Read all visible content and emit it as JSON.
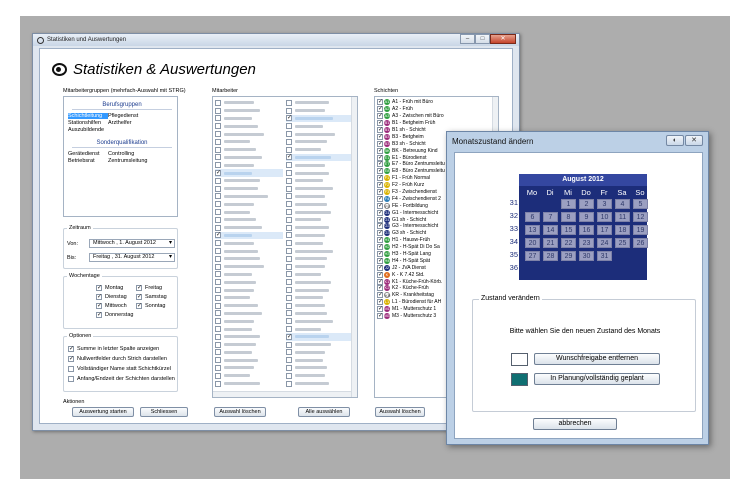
{
  "main_window": {
    "title": "Statistiken und Auswertungen",
    "heading": "Statistiken & Auswertungen",
    "mitarbeitergruppen_label": "Mitarbeitergruppen (mehrfach-Auswahl mit STRG)",
    "berufsgruppen_label": "Berufsgruppen",
    "berufsgruppen": [
      [
        "Schichtleitung",
        "Pflegedienst"
      ],
      [
        "Stationshilfen",
        "Arzthelfer"
      ],
      [
        "Auszubildende",
        ""
      ]
    ],
    "sonderqualifikation_label": "Sonderqualifikation",
    "sonderqualifikation": [
      [
        "Gerätedienst",
        "Controlling"
      ],
      [
        "Betriebsrat",
        "Zentrumsleitung"
      ]
    ],
    "zeitraum_label": "Zeitraum",
    "von_label": "Von:",
    "von_value": "Mittwoch  ,  1.   August   2012",
    "bis_label": "Bis:",
    "bis_value": "Freitag  ,  31.   August   2012",
    "wochentage_label": "Wochentage",
    "wochentage_col1": [
      "Montag",
      "Dienstag",
      "Mittwoch",
      "Donnerstag"
    ],
    "wochentage_col2": [
      "Freitag",
      "Samstag",
      "Sonntag"
    ],
    "optionen_label": "Optionen",
    "optionen": [
      {
        "label": "Summe in letzter Spalte anzeigen",
        "checked": true
      },
      {
        "label": "Nullwertfelder durch Strich darstellen",
        "checked": true
      },
      {
        "label": "Vollständiger Name statt Schichtkürzel",
        "checked": false
      },
      {
        "label": "Anfang/Endzeit der Schichten darstellen",
        "checked": false
      }
    ],
    "aktionen_label": "Aktionen",
    "auswertung_button": "Auswertung starten",
    "schliessen_button": "Schliessen",
    "mitarbeiter_label": "Mitarbeiter",
    "auswahl_loeschen_button": "Auswahl löschen",
    "alle_auswaehlen_button": "Alle auswählen",
    "schichten_label": "Schichten",
    "schichten_auswahl_loeschen_button": "Auswahl löschen",
    "schichten": [
      {
        "code": "A1",
        "label": "A1 - Früh mit Büro",
        "color": "#2f9e3f"
      },
      {
        "code": "A2",
        "label": "A2 - Früh",
        "color": "#2f9e3f"
      },
      {
        "code": "A3",
        "label": "A3 - Zwischen mit Büro",
        "color": "#2f9e3f"
      },
      {
        "code": "B1",
        "label": "B1 - Betgheim Früh",
        "color": "#9c2a7a"
      },
      {
        "code": "B1",
        "label": "B1 sh - Schicht",
        "color": "#9c2a7a"
      },
      {
        "code": "B3",
        "label": "B3 - Betgheim",
        "color": "#9c2a7a"
      },
      {
        "code": "B3",
        "label": "B3 sh - Schicht",
        "color": "#9c2a7a"
      },
      {
        "code": "BK",
        "label": "BK - Betreuung Kind",
        "color": "#2f9e3f"
      },
      {
        "code": "E1",
        "label": "E1 - Bürodienst",
        "color": "#2f9e3f"
      },
      {
        "code": "E7",
        "label": "E7 - Büro Zentrumsleitu",
        "color": "#2f9e3f"
      },
      {
        "code": "E8",
        "label": "E8 - Büro Zentrumsleitu",
        "color": "#2f9e3f"
      },
      {
        "code": "F1",
        "label": "F1 - Früh Normal",
        "color": "#d9b300"
      },
      {
        "code": "F2",
        "label": "F2 - Früh Kurz",
        "color": "#d9b300"
      },
      {
        "code": "F3",
        "label": "F3 - Zwischendienst",
        "color": "#d9b300"
      },
      {
        "code": "F4",
        "label": "F4 - Zwischendienst 2",
        "color": "#2c7fb8"
      },
      {
        "code": "FE",
        "label": "FE - Fortbildung",
        "color": "#ffffff"
      },
      {
        "code": "G1",
        "label": "G1 - Intermesschicht",
        "color": "#1c2d7a"
      },
      {
        "code": "G1",
        "label": "G1 sh - Schicht",
        "color": "#1c2d7a"
      },
      {
        "code": "G3",
        "label": "G3 - Intermesschicht",
        "color": "#1c2d7a"
      },
      {
        "code": "G3",
        "label": "G3 sh - Schicht",
        "color": "#1c2d7a"
      },
      {
        "code": "H1",
        "label": "H1 - Hausw-Früh",
        "color": "#2f9e3f"
      },
      {
        "code": "H2",
        "label": "H2 - H-Spät Di Do Sa",
        "color": "#2f9e3f"
      },
      {
        "code": "H3",
        "label": "H3 - H-Spät Lang",
        "color": "#2f9e3f"
      },
      {
        "code": "H4",
        "label": "H4 - H-Spät Spät",
        "color": "#2f9e3f"
      },
      {
        "code": "J2",
        "label": "J2 - JVA Dienst",
        "color": "#1c2d7a"
      },
      {
        "code": "K",
        "label": "K - K 7.42 Std.",
        "color": "#e06a1a"
      },
      {
        "code": "K1",
        "label": "K1 - Küche-Früh-Körb.",
        "color": "#9c2a7a"
      },
      {
        "code": "K2",
        "label": "K2 - Küche-Früh",
        "color": "#9c2a7a"
      },
      {
        "code": "KR",
        "label": "KR - Krankheitstag",
        "color": "#ffffff"
      },
      {
        "code": "L1",
        "label": "L1 - Bürodienst für AH",
        "color": "#d9b300"
      },
      {
        "code": "M1",
        "label": "M1 - Mutterschutz 1",
        "color": "#9c2a7a"
      },
      {
        "code": "M3",
        "label": "M3 - Mutterschutz 3",
        "color": "#9c2a7a"
      }
    ]
  },
  "dialog": {
    "title": "Monatszustand ändern",
    "month_header": "August 2012",
    "weekdays": [
      "Mo",
      "Di",
      "Mi",
      "Do",
      "Fr",
      "Sa",
      "So"
    ],
    "week_numbers": [
      "31",
      "32",
      "33",
      "34",
      "35",
      "36"
    ],
    "weeks": [
      [
        "",
        "",
        "1",
        "2",
        "3",
        "4",
        "5"
      ],
      [
        "6",
        "7",
        "8",
        "9",
        "10",
        "11",
        "12"
      ],
      [
        "13",
        "14",
        "15",
        "16",
        "17",
        "18",
        "19"
      ],
      [
        "20",
        "21",
        "22",
        "23",
        "24",
        "25",
        "26"
      ],
      [
        "27",
        "28",
        "29",
        "30",
        "31",
        "",
        ""
      ],
      [
        "",
        "",
        "",
        "",
        "",
        "",
        ""
      ]
    ],
    "zustand_label": "Zustand verändern",
    "prompt": "Bitte wählen Sie den neuen Zustand des Monats",
    "option1_button": "Wunschfreigabe entfernen",
    "option1_color": "#ffffff",
    "option2_button": "In Planung/vollständig geplant",
    "option2_color": "#0f6f72",
    "cancel_button": "abbrechen"
  }
}
